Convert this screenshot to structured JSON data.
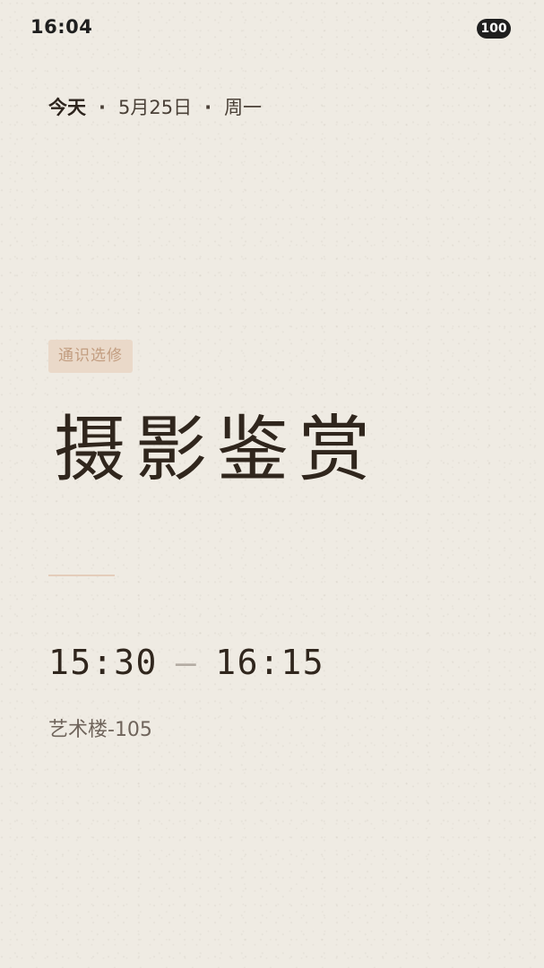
{
  "status_bar": {
    "time": "16:04",
    "battery": "100"
  },
  "date": {
    "today": "今天",
    "separator": "·",
    "day": "5月25日",
    "weekday": "周一"
  },
  "course": {
    "category": "通识选修",
    "title": "摄影鉴赏",
    "start_time": "15:30",
    "dash": "—",
    "end_time": "16:15",
    "location": "艺术楼-105"
  },
  "colors": {
    "background": "#efebe3",
    "tag_background": "#ead9c9",
    "tag_text": "#c29d80",
    "title_text": "#30261d",
    "divider": "#e4cdbb"
  }
}
